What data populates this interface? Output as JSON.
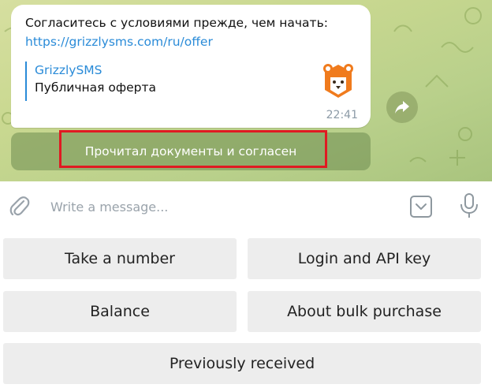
{
  "message": {
    "text": "Согласитесь с условиями прежде, чем начать:",
    "link": "https://grizzlysms.com/ru/offer",
    "preview_site": "GrizzlySMS",
    "preview_title": "Публичная оферта",
    "time": "22:41",
    "preview_icon": "bear-logo"
  },
  "inline_button": {
    "label": "Прочитал документы и согласен"
  },
  "composer": {
    "placeholder": "Write a message..."
  },
  "keyboard": {
    "buttons": [
      "Take a number",
      "Login and API key",
      "Balance",
      "About bulk purchase",
      "Previously received"
    ]
  },
  "colors": {
    "link": "#2a8bd8",
    "highlight": "#e01a22",
    "bear": "#f07b1d"
  }
}
